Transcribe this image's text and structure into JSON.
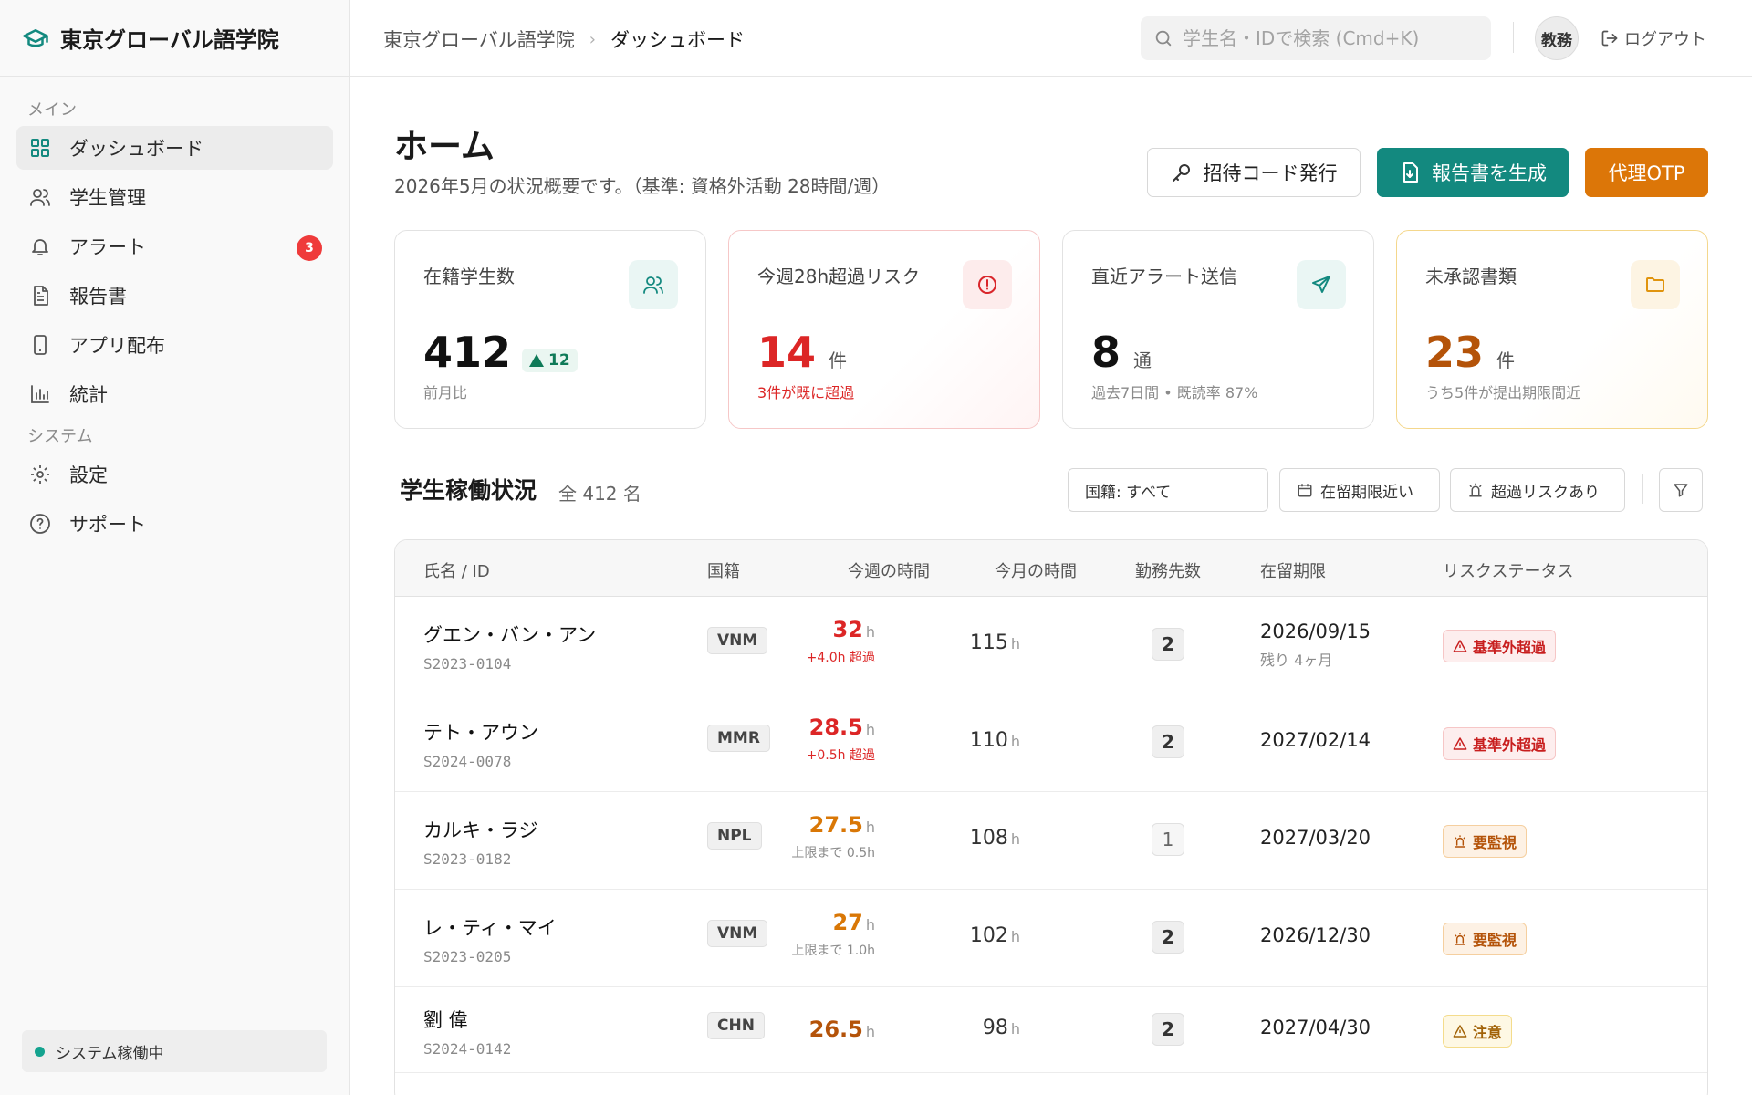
{
  "brand": {
    "name": "東京グローバル語学院"
  },
  "sidebar": {
    "sections": {
      "main": "メイン",
      "system": "システム"
    },
    "items": [
      {
        "label": "ダッシュボード"
      },
      {
        "label": "学生管理"
      },
      {
        "label": "アラート",
        "badge": "3"
      },
      {
        "label": "報告書"
      },
      {
        "label": "アプリ配布"
      },
      {
        "label": "統計"
      },
      {
        "label": "設定"
      },
      {
        "label": "サポート"
      }
    ],
    "status": "システム稼働中"
  },
  "topbar": {
    "breadcrumb": [
      "東京グローバル語学院",
      "ダッシュボード"
    ],
    "search_placeholder": "学生名・IDで検索 (Cmd+K)",
    "avatar": "教務",
    "logout": "ログアウト"
  },
  "page": {
    "title": "ホーム",
    "subtitle": "2026年5月の状況概要です。（基準: 資格外活動 28時間/週）",
    "buttons": {
      "invite": "招待コード発行",
      "report": "報告書を生成",
      "otp": "代理OTP"
    }
  },
  "cards": [
    {
      "label": "在籍学生数",
      "value": "412",
      "delta": "12",
      "note": "前月比"
    },
    {
      "label": "今週28h超過リスク",
      "value": "14",
      "unit": "件",
      "note": "3件が既に超過"
    },
    {
      "label": "直近アラート送信",
      "value": "8",
      "unit": "通",
      "note": "過去7日間 • 既読率 87%"
    },
    {
      "label": "未承認書類",
      "value": "23",
      "unit": "件",
      "note": "うち5件が提出期限間近"
    }
  ],
  "section": {
    "title": "学生稼働状況",
    "count": "全 412 名",
    "filters": {
      "nationality": "国籍: すべて",
      "visa": "在留期限近い",
      "risk": "超過リスクあり"
    }
  },
  "table": {
    "headers": [
      "氏名 / ID",
      "国籍",
      "今週の時間",
      "今月の時間",
      "勤務先数",
      "在留期限",
      "リスクステータス"
    ],
    "hour_unit": "h",
    "rows": [
      {
        "name": "グエン・バン・アン",
        "id": "S2023-0104",
        "nat": "VNM",
        "week": "32",
        "week_note": "+4.0h 超過",
        "month": "115",
        "emp": "2",
        "visa": "2026/09/15",
        "visa_note": "残り 4ヶ月",
        "status": "基準外超過"
      },
      {
        "name": "テト・アウン",
        "id": "S2024-0078",
        "nat": "MMR",
        "week": "28.5",
        "week_note": "+0.5h 超過",
        "month": "110",
        "emp": "2",
        "visa": "2027/02/14",
        "visa_note": "",
        "status": "基準外超過"
      },
      {
        "name": "カルキ・ラジ",
        "id": "S2023-0182",
        "nat": "NPL",
        "week": "27.5",
        "week_note": "上限まで 0.5h",
        "month": "108",
        "emp": "1",
        "visa": "2027/03/20",
        "visa_note": "",
        "status": "要監視"
      },
      {
        "name": "レ・ティ・マイ",
        "id": "S2023-0205",
        "nat": "VNM",
        "week": "27",
        "week_note": "上限まで 1.0h",
        "month": "102",
        "emp": "2",
        "visa": "2026/12/30",
        "visa_note": "",
        "status": "要監視"
      },
      {
        "name": "劉 偉",
        "id": "S2024-0142",
        "nat": "CHN",
        "week": "26.5",
        "week_note": "",
        "month": "98",
        "emp": "2",
        "visa": "2027/04/30",
        "visa_note": "",
        "status": "注意"
      }
    ]
  },
  "colors": {
    "accent": "#13897f",
    "danger": "#dc2626",
    "warning": "#d97706",
    "otp": "#dc7608"
  }
}
